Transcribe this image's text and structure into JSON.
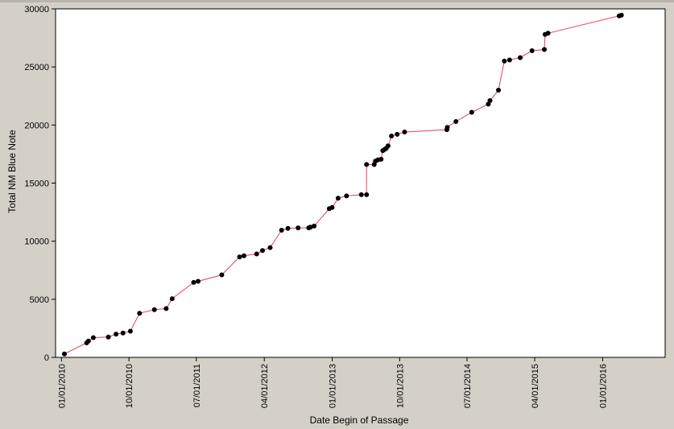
{
  "chart_data": {
    "type": "line",
    "title": "",
    "xlabel": "Date Begin of Passage",
    "ylabel": "Total NM Blue Note",
    "x_type": "date",
    "xlim": [
      "2009-12-08",
      "2016-09-10"
    ],
    "ylim": [
      0,
      30000
    ],
    "x_ticks": [
      "2010-01-01",
      "2010-10-01",
      "2011-07-01",
      "2012-04-01",
      "2013-01-01",
      "2013-10-01",
      "2014-07-01",
      "2015-04-01",
      "2016-01-01"
    ],
    "x_tick_labels": [
      "01/01/2010",
      "10/01/2010",
      "07/01/2011",
      "04/01/2012",
      "01/01/2013",
      "10/01/2013",
      "07/01/2014",
      "04/01/2015",
      "01/01/2016"
    ],
    "y_ticks": [
      0,
      5000,
      10000,
      15000,
      20000,
      25000,
      30000
    ],
    "y_tick_labels": [
      "0",
      "5000",
      "10000",
      "15000",
      "20000",
      "25000",
      "30000"
    ],
    "grid": false,
    "colors": {
      "line": "#e0405a",
      "marker": "#000000",
      "plot_bg": "#ffffff",
      "frame_bg": "#d4d0c8"
    },
    "series": [
      {
        "points": [
          [
            "2010-01-13",
            300
          ],
          [
            "2010-04-13",
            1250
          ],
          [
            "2010-04-20",
            1400
          ],
          [
            "2010-05-10",
            1700
          ],
          [
            "2010-07-10",
            1750
          ],
          [
            "2010-08-10",
            2000
          ],
          [
            "2010-09-07",
            2100
          ],
          [
            "2010-10-07",
            2250
          ],
          [
            "2010-11-13",
            3800
          ],
          [
            "2011-01-12",
            4100
          ],
          [
            "2011-03-01",
            4200
          ],
          [
            "2011-03-25",
            5050
          ],
          [
            "2011-06-20",
            6450
          ],
          [
            "2011-07-08",
            6550
          ],
          [
            "2011-10-12",
            7100
          ],
          [
            "2011-12-23",
            8650
          ],
          [
            "2012-01-10",
            8750
          ],
          [
            "2012-03-01",
            8900
          ],
          [
            "2012-03-25",
            9200
          ],
          [
            "2012-04-25",
            9450
          ],
          [
            "2012-06-10",
            10950
          ],
          [
            "2012-07-06",
            11100
          ],
          [
            "2012-08-16",
            11150
          ],
          [
            "2012-09-28",
            11150
          ],
          [
            "2012-10-05",
            11200
          ],
          [
            "2012-10-20",
            11300
          ],
          [
            "2012-12-20",
            12800
          ],
          [
            "2013-01-01",
            12900
          ],
          [
            "2013-01-25",
            13700
          ],
          [
            "2013-02-28",
            13900
          ],
          [
            "2013-04-29",
            14000
          ],
          [
            "2013-05-20",
            14000
          ],
          [
            "2013-05-20",
            16600
          ],
          [
            "2013-06-20",
            16600
          ],
          [
            "2013-06-25",
            16900
          ],
          [
            "2013-07-05",
            17000
          ],
          [
            "2013-07-18",
            17050
          ],
          [
            "2013-07-25",
            17800
          ],
          [
            "2013-08-01",
            17900
          ],
          [
            "2013-08-08",
            18000
          ],
          [
            "2013-08-15",
            18200
          ],
          [
            "2013-08-29",
            19050
          ],
          [
            "2013-09-21",
            19200
          ],
          [
            "2013-10-21",
            19400
          ],
          [
            "2014-04-10",
            19600
          ],
          [
            "2014-04-12",
            19800
          ],
          [
            "2014-05-17",
            20300
          ],
          [
            "2014-07-20",
            21100
          ],
          [
            "2014-09-25",
            21800
          ],
          [
            "2014-10-02",
            22100
          ],
          [
            "2014-11-05",
            23000
          ],
          [
            "2014-11-29",
            25500
          ],
          [
            "2014-12-20",
            25600
          ],
          [
            "2015-02-01",
            25800
          ],
          [
            "2015-03-21",
            26400
          ],
          [
            "2015-05-10",
            26500
          ],
          [
            "2015-05-13",
            27800
          ],
          [
            "2015-05-25",
            27900
          ],
          [
            "2016-03-08",
            29400
          ],
          [
            "2016-03-17",
            29450
          ]
        ]
      }
    ]
  }
}
